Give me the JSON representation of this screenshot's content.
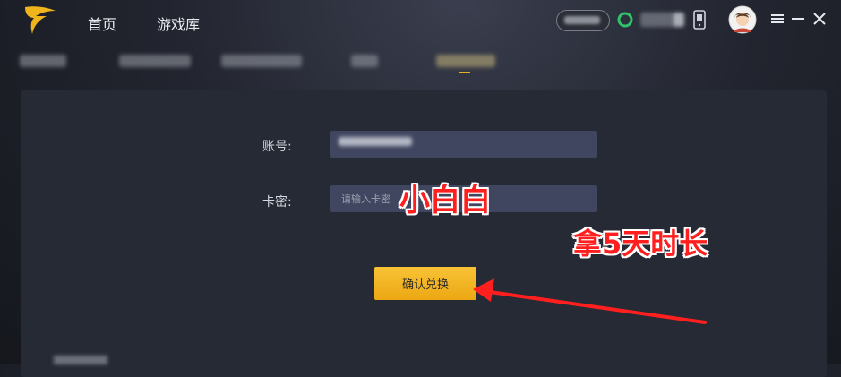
{
  "topbar": {
    "nav": [
      {
        "label": "首页"
      },
      {
        "label": "游戏库"
      }
    ]
  },
  "form": {
    "account_label": "账号:",
    "key_label": "卡密:",
    "key_placeholder": "请输入卡密",
    "redeem_label": "确认兑换"
  },
  "annotations": {
    "name": "小白白",
    "reward": "拿5天时长"
  },
  "colors": {
    "accent": "#f2b124",
    "annotation": "#ff1f1f",
    "field_bg": "#414660",
    "panel_bg": "#262a34"
  },
  "icons": [
    "logo-icon",
    "wifi-icon",
    "phone-icon",
    "avatar",
    "menu-icon",
    "minimize-icon",
    "close-icon"
  ]
}
